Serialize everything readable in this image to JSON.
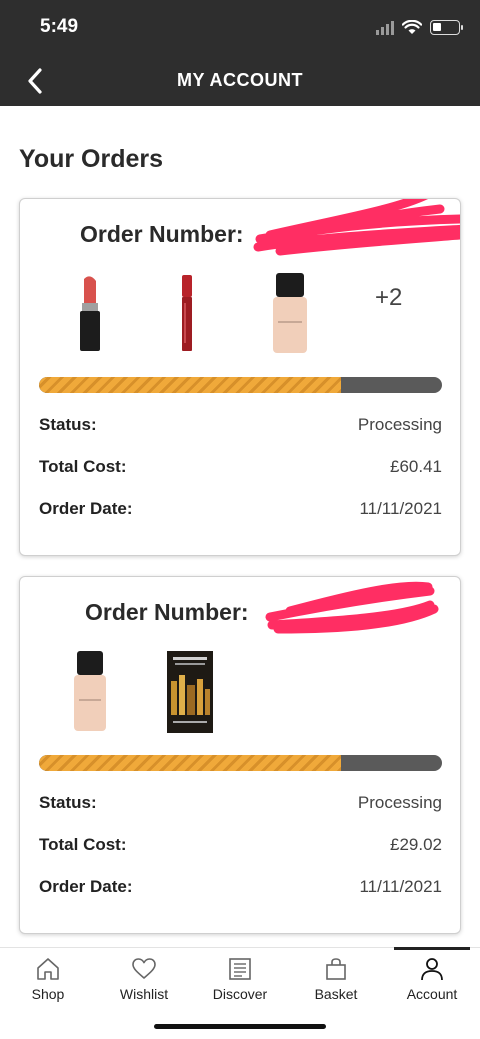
{
  "status_bar": {
    "time": "5:49"
  },
  "header": {
    "title": "MY ACCOUNT"
  },
  "section_title": "Your Orders",
  "orders": [
    {
      "order_number_label": "Order Number:",
      "more_products": "+2",
      "progress": 0.75,
      "status_label": "Status:",
      "status_value": "Processing",
      "total_label": "Total Cost:",
      "total_value": "£60.41",
      "date_label": "Order Date:",
      "date_value": "11/11/2021"
    },
    {
      "order_number_label": "Order Number:",
      "progress": 0.75,
      "status_label": "Status:",
      "status_value": "Processing",
      "total_label": "Total Cost:",
      "total_value": "£29.02",
      "date_label": "Order Date:",
      "date_value": "11/11/2021"
    }
  ],
  "tabbar": {
    "items": [
      {
        "label": "Shop",
        "icon": "home-icon"
      },
      {
        "label": "Wishlist",
        "icon": "heart-icon"
      },
      {
        "label": "Discover",
        "icon": "newspaper-icon"
      },
      {
        "label": "Basket",
        "icon": "bag-icon"
      },
      {
        "label": "Account",
        "icon": "user-icon"
      }
    ],
    "active": "Account"
  },
  "colors": {
    "header_bg": "#2e2e2e",
    "progress_fill": "#f0a93a",
    "progress_track": "#5a5a5a",
    "redaction": "#ff2e63"
  }
}
